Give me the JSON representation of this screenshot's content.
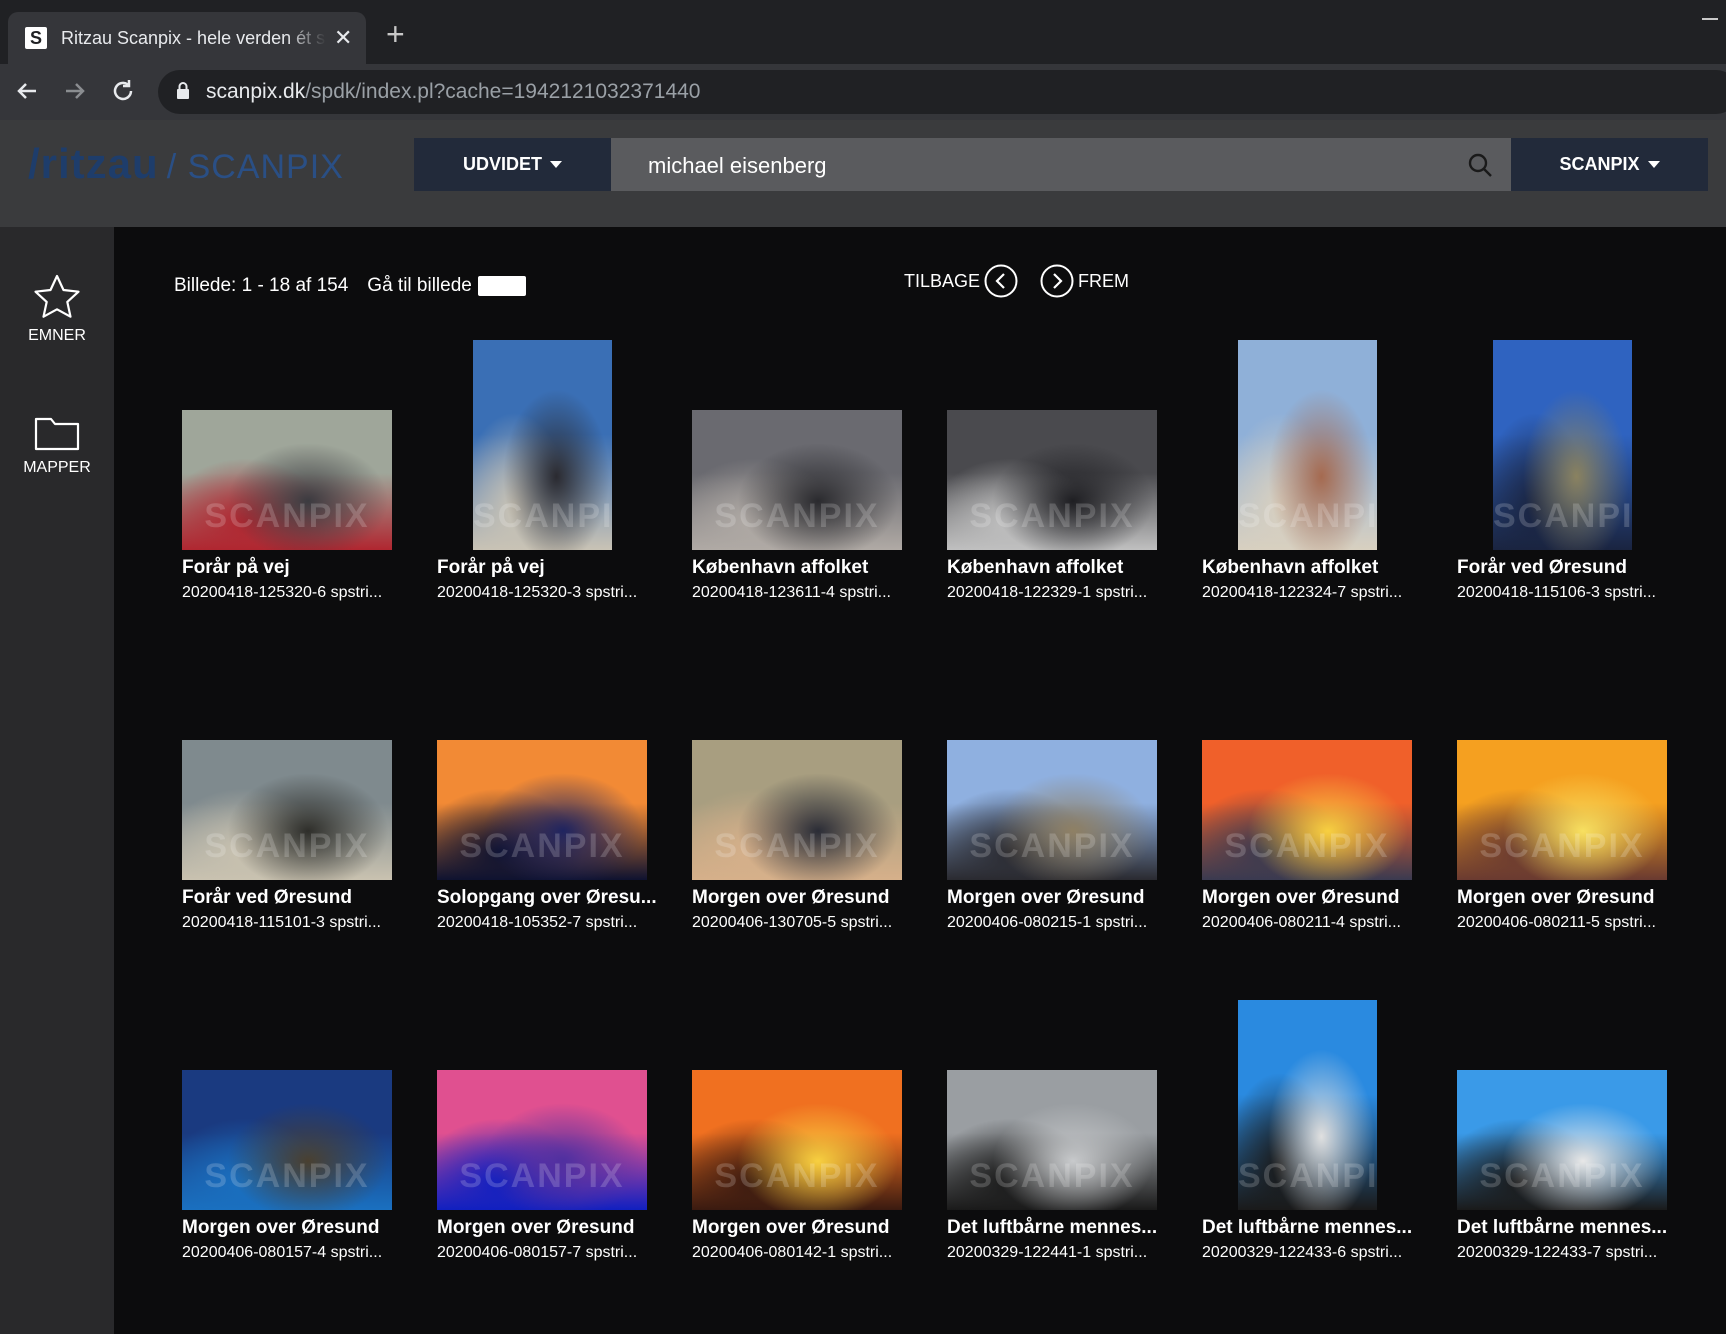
{
  "browser": {
    "tab_title": "Ritzau Scanpix - hele verden ét sted",
    "favicon_letter": "S",
    "new_tab_symbol": "+",
    "url_host": "scanpix.dk",
    "url_path": "/spdk/index.pl?cache=1942121032371440"
  },
  "header": {
    "logo_ritzau": "/ritzau",
    "logo_scanpix": "/ SCANPIX",
    "udvidet_label": "UDVIDET",
    "search_value": "michael eisenberg",
    "scanpix_label": "SCANPIX"
  },
  "sidebar": {
    "items": [
      {
        "label": "EMNER",
        "icon": "star-icon"
      },
      {
        "label": "MAPPER",
        "icon": "folder-icon"
      }
    ]
  },
  "results": {
    "count_text": "Billede: 1 - 18 af 154",
    "goto_label": "Gå til billede",
    "back_label": "TILBAGE",
    "forward_label": "FREM"
  },
  "watermark": "SCANPIX",
  "items": [
    {
      "title": "Forår på vej",
      "id": "20200418-125320-6 spstri...",
      "orientation": "landscape",
      "colors": [
        "#9fa69a",
        "#3b3b40",
        "#b02630"
      ]
    },
    {
      "title": "Forår på vej",
      "id": "20200418-125320-3 spstri...",
      "orientation": "portrait",
      "colors": [
        "#3a6fb5",
        "#2a2a30",
        "#c9c3b5"
      ]
    },
    {
      "title": "København affolket",
      "id": "20200418-123611-4 spstri...",
      "orientation": "landscape",
      "colors": [
        "#6a6a70",
        "#2a2a2e",
        "#b0aaa5"
      ]
    },
    {
      "title": "København affolket",
      "id": "20200418-122329-1 spstri...",
      "orientation": "landscape",
      "colors": [
        "#4a4a4e",
        "#1e1e22",
        "#c0c0c0"
      ]
    },
    {
      "title": "København affolket",
      "id": "20200418-122324-7 spstri...",
      "orientation": "portrait",
      "colors": [
        "#8fb0d8",
        "#a56a50",
        "#d8d0c0"
      ]
    },
    {
      "title": "Forår ved Øresund",
      "id": "20200418-115106-3 spstri...",
      "orientation": "portrait",
      "colors": [
        "#2f63c0",
        "#8a8260",
        "#1a2440"
      ]
    },
    {
      "title": "Forår ved Øresund",
      "id": "20200418-115101-3 spstri...",
      "orientation": "landscape",
      "colors": [
        "#7f8a8e",
        "#2e2e2a",
        "#c9c2b0"
      ]
    },
    {
      "title": "Solopgang over Øresu...",
      "id": "20200418-105352-7 spstri...",
      "orientation": "landscape",
      "colors": [
        "#f28a35",
        "#1f2460",
        "#0e1230"
      ]
    },
    {
      "title": "Morgen over Øresund",
      "id": "20200406-130705-5 spstri...",
      "orientation": "landscape",
      "colors": [
        "#a89e80",
        "#2a2c36",
        "#d6b08a"
      ]
    },
    {
      "title": "Morgen over Øresund",
      "id": "20200406-080215-1 spstri...",
      "orientation": "landscape",
      "colors": [
        "#8fb0e0",
        "#8f8064",
        "#2a2a30"
      ]
    },
    {
      "title": "Morgen over Øresund",
      "id": "20200406-080211-4 spstri...",
      "orientation": "landscape",
      "colors": [
        "#f0602a",
        "#f8d040",
        "#3a3a50"
      ]
    },
    {
      "title": "Morgen over Øresund",
      "id": "20200406-080211-5 spstri...",
      "orientation": "landscape",
      "colors": [
        "#f5a020",
        "#f8e060",
        "#6a3a30"
      ]
    },
    {
      "title": "Morgen over Øresund",
      "id": "20200406-080157-4 spstri...",
      "orientation": "landscape",
      "colors": [
        "#1a3a80",
        "#4a4030",
        "#1a70c0"
      ]
    },
    {
      "title": "Morgen over Øresund",
      "id": "20200406-080157-7 spstri...",
      "orientation": "landscape",
      "colors": [
        "#e05090",
        "#5030a0",
        "#1020c0"
      ]
    },
    {
      "title": "Morgen over Øresund",
      "id": "20200406-080142-1 spstri...",
      "orientation": "landscape",
      "colors": [
        "#f07020",
        "#f8d040",
        "#3a1a10"
      ]
    },
    {
      "title": "Det luftbårne mennes...",
      "id": "20200329-122441-1 spstri...",
      "orientation": "landscape",
      "colors": [
        "#9a9ea2",
        "#c8cacc",
        "#1a1a1a"
      ]
    },
    {
      "title": "Det luftbårne mennes...",
      "id": "20200329-122433-6 spstri...",
      "orientation": "portrait",
      "colors": [
        "#2a8ae0",
        "#e0e0e0",
        "#1a1a1a"
      ]
    },
    {
      "title": "Det luftbårne mennes...",
      "id": "20200329-122433-7 spstri...",
      "orientation": "landscape",
      "colors": [
        "#3a9ae8",
        "#e8e8e8",
        "#1a1a1a"
      ]
    }
  ]
}
